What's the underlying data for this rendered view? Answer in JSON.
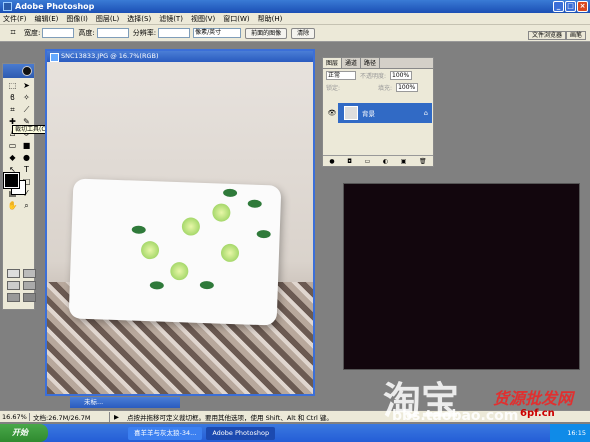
{
  "app": {
    "title": "Adobe Photoshop"
  },
  "menu": [
    "文件(F)",
    "编辑(E)",
    "图像(I)",
    "图层(L)",
    "选择(S)",
    "滤镜(T)",
    "视图(V)",
    "窗口(W)",
    "帮助(H)"
  ],
  "options": {
    "width_label": "宽度:",
    "height_label": "高度:",
    "res_label": "分辨率:",
    "unit": "像素/英寸",
    "front_btn": "前面的图像",
    "clear_btn": "清除"
  },
  "palette_well": [
    "文件浏览器",
    "画笔"
  ],
  "tooltip": "裁切工具(C)",
  "document": {
    "title": "SNC13833.JPG @ 16.7%(RGB)"
  },
  "layers": {
    "tabs": [
      "图层",
      "通道",
      "路径"
    ],
    "blend": "正常",
    "opacity_label": "不透明度:",
    "opacity": "100%",
    "lock_label": "锁定:",
    "fill_label": "填充:",
    "fill": "100%",
    "layer_name": "背景"
  },
  "minidoc": "未标...",
  "status": {
    "zoom": "16.67%",
    "doc": "文档:26.7M/26.7M",
    "hint": "点按并拖移可定义裁切框。要用其他选项，使用 Shift、Alt 和 Ctrl 键。"
  },
  "taskbar": {
    "start": "开始",
    "tasks": [
      "喜羊羊与灰太狼-34...",
      "Adobe Photoshop"
    ],
    "clock": "16:15"
  },
  "watermarks": [
    "淘宝",
    "bbs.taobao.com",
    "货源批发网",
    "6pf.cn"
  ],
  "colors": {
    "titlebar": "#245dd6",
    "foreground": "#000000",
    "background": "#ffffff"
  }
}
